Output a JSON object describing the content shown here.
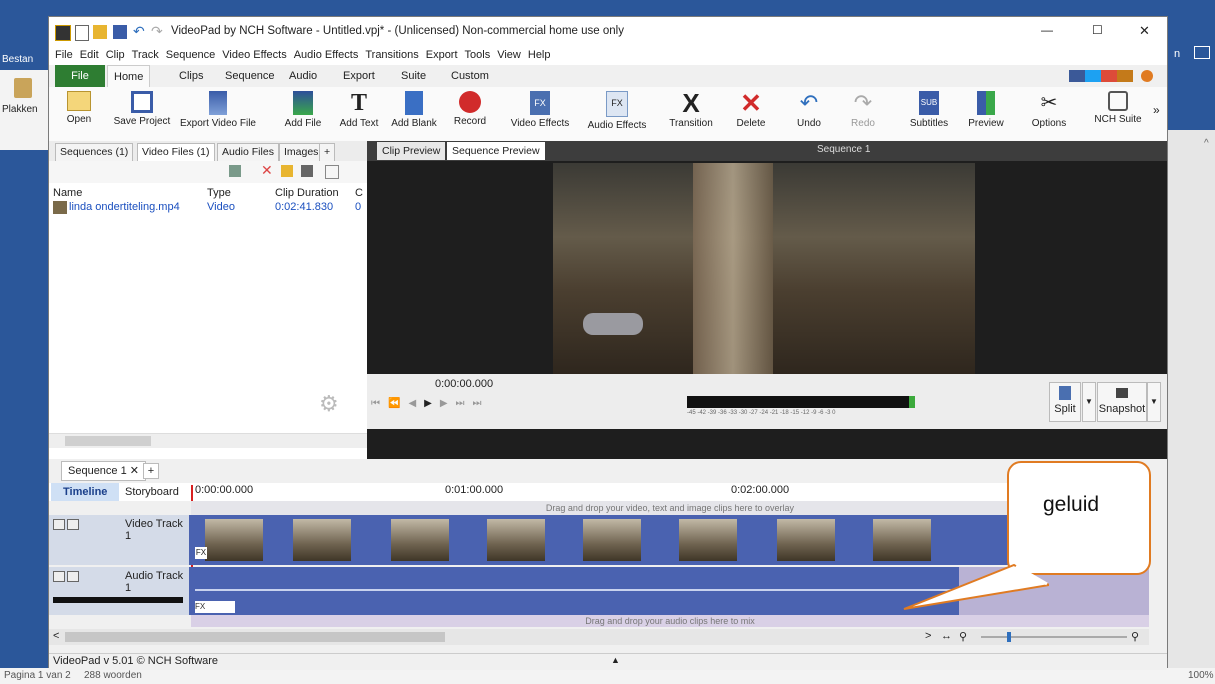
{
  "word": {
    "left_ribbon": {
      "tab_start": "Bestan",
      "paste_label": "Plakken"
    },
    "status": {
      "page": "Pagina 1 van 2",
      "words": "288 woorden",
      "zoom": "100%"
    },
    "right_tab_fragment": "n"
  },
  "window": {
    "title": "VideoPad by NCH Software - Untitled.vpj* - (Unlicensed) Non-commercial home use only",
    "controls": {
      "minimize": "—",
      "maximize": "☐",
      "close": "✕"
    }
  },
  "menu": [
    "File",
    "Edit",
    "Clip",
    "Track",
    "Sequence",
    "Video Effects",
    "Audio Effects",
    "Transitions",
    "Export",
    "Tools",
    "View",
    "Help"
  ],
  "ribbon_tabs": [
    "File",
    "Home",
    "Clips",
    "Sequence",
    "Audio",
    "Export",
    "Suite",
    "Custom"
  ],
  "toolbar": [
    {
      "label": "Open",
      "icon": "folder-icon"
    },
    {
      "label": "Save Project",
      "icon": "save-icon"
    },
    {
      "label": "Export Video File",
      "icon": "export-icon"
    },
    {
      "label": "Add File",
      "icon": "add-file-icon"
    },
    {
      "label": "Add Text",
      "icon": "text-icon"
    },
    {
      "label": "Add Blank",
      "icon": "blank-icon"
    },
    {
      "label": "Record",
      "icon": "record-icon"
    },
    {
      "label": "Video Effects",
      "icon": "video-fx-icon"
    },
    {
      "label": "Audio Effects",
      "icon": "audio-fx-icon"
    },
    {
      "label": "Transition",
      "icon": "transition-icon"
    },
    {
      "label": "Delete",
      "icon": "delete-icon"
    },
    {
      "label": "Undo",
      "icon": "undo-icon"
    },
    {
      "label": "Redo",
      "icon": "redo-icon"
    },
    {
      "label": "Subtitles",
      "icon": "subtitles-icon"
    },
    {
      "label": "Preview",
      "icon": "preview-icon"
    },
    {
      "label": "Options",
      "icon": "options-icon"
    },
    {
      "label": "NCH Suite",
      "icon": "suite-icon"
    }
  ],
  "bin": {
    "tabs": [
      "Sequences (1)",
      "Video Files (1)",
      "Audio Files",
      "Images",
      "+"
    ],
    "columns": [
      "Name",
      "Type",
      "Clip Duration",
      "C"
    ],
    "files": [
      {
        "name": "linda ondertiteling.mp4",
        "type": "Video",
        "duration": "0:02:41.830",
        "extra": "0"
      }
    ]
  },
  "preview": {
    "tabs": [
      "Clip Preview",
      "Sequence Preview"
    ],
    "sequence_label": "Sequence 1",
    "time": "0:00:00.000",
    "split_label": "Split",
    "snapshot_label": "Snapshot",
    "meter_ticks": "-45 -42 -39 -36 -33 -30 -27 -24 -21 -18 -15 -12 -9 -6 -3 0"
  },
  "timeline": {
    "seq_tab": "Sequence 1",
    "view_tabs": [
      "Timeline",
      "Storyboard"
    ],
    "ruler": [
      "0:00:00.000",
      "0:01:00.000",
      "0:02:00.000"
    ],
    "overlay_hint": "Drag and drop your video, text and image clips here to overlay",
    "video_track": "Video Track 1",
    "audio_track": "Audio Track 1",
    "audio_hint": "Drag and drop your audio clips here to mix",
    "fx_label": "FX"
  },
  "callout": {
    "text": "geluid"
  },
  "status": {
    "version": "VideoPad v 5.01 © NCH Software"
  },
  "colors": {
    "accent": "#2b579a",
    "file_tab": "#2e7d32",
    "track_blue": "#4a62b0",
    "callout_border": "#e07b22"
  }
}
